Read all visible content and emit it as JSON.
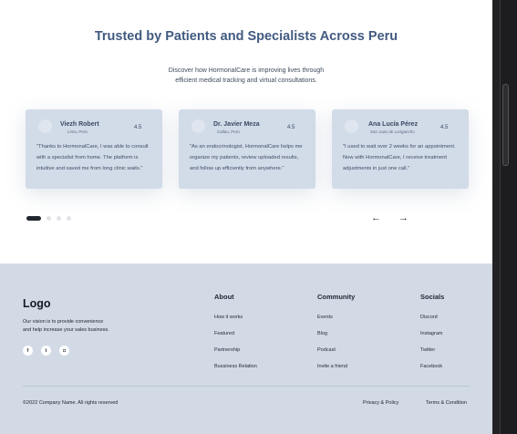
{
  "section": {
    "title": "Trusted by Patients and Specialists Across Peru",
    "subtitle_line1": "Discover how HormonalCare is improving lives through",
    "subtitle_line2": "efficient medical tracking and virtual consultations."
  },
  "testimonials": [
    {
      "name": "Viezh Robert",
      "location": "Lima, Perú",
      "rating": "4.5",
      "quote": "\"Thanks to HormonalCare, I was able to consult with a specialist from home. The platform is intuitive and saved me from long clinic waits.\""
    },
    {
      "name": "Dr. Javier Meza",
      "location": "Callao, Perú",
      "rating": "4.5",
      "quote": "\"As an endocrinologist, HormonalCare helps me organize my patients, review uploaded results, and follow up efficiently from anywhere.\""
    },
    {
      "name": "Ana Lucía Pérez",
      "location": "San Juan de Lurigancho",
      "rating": "4.5",
      "quote": "\"I used to wait over 2 weeks for an appointment. Now with HormonalCare, I receive treatment adjustments in just one call.\""
    }
  ],
  "carousel": {
    "active_index": 0,
    "page_count": 4,
    "prev_icon": "arrow-left-icon",
    "next_icon": "arrow-right-icon",
    "prev_glyph": "←",
    "next_glyph": "→"
  },
  "footer": {
    "logo": "Logo",
    "vision_line1": "Our vision is to provide convenience",
    "vision_line2": "and help increase your sales business.",
    "socials": [
      {
        "icon": "facebook-icon",
        "glyph": "f"
      },
      {
        "icon": "twitter-icon",
        "glyph": "t"
      },
      {
        "icon": "instagram-icon",
        "glyph": "◘"
      }
    ],
    "columns": [
      {
        "heading": "About",
        "links": [
          "How it works",
          "Featured",
          "Partnership",
          "Bussiness Relation"
        ]
      },
      {
        "heading": "Community",
        "links": [
          "Events",
          "Blog",
          "Podcast",
          "Invite a friend"
        ]
      },
      {
        "heading": "Socials",
        "links": [
          "Discord",
          "Instagram",
          "Twitter",
          "Facebook"
        ]
      }
    ],
    "copyright": "©2022 Company Name. All rights reserved",
    "privacy": "Privacy & Policy",
    "terms": "Terms & Condition"
  },
  "colors": {
    "accent_title": "#415a80",
    "card_bg": "#d2dbe8",
    "footer_bg": "#d2dae6",
    "dot_active": "#22262e"
  }
}
